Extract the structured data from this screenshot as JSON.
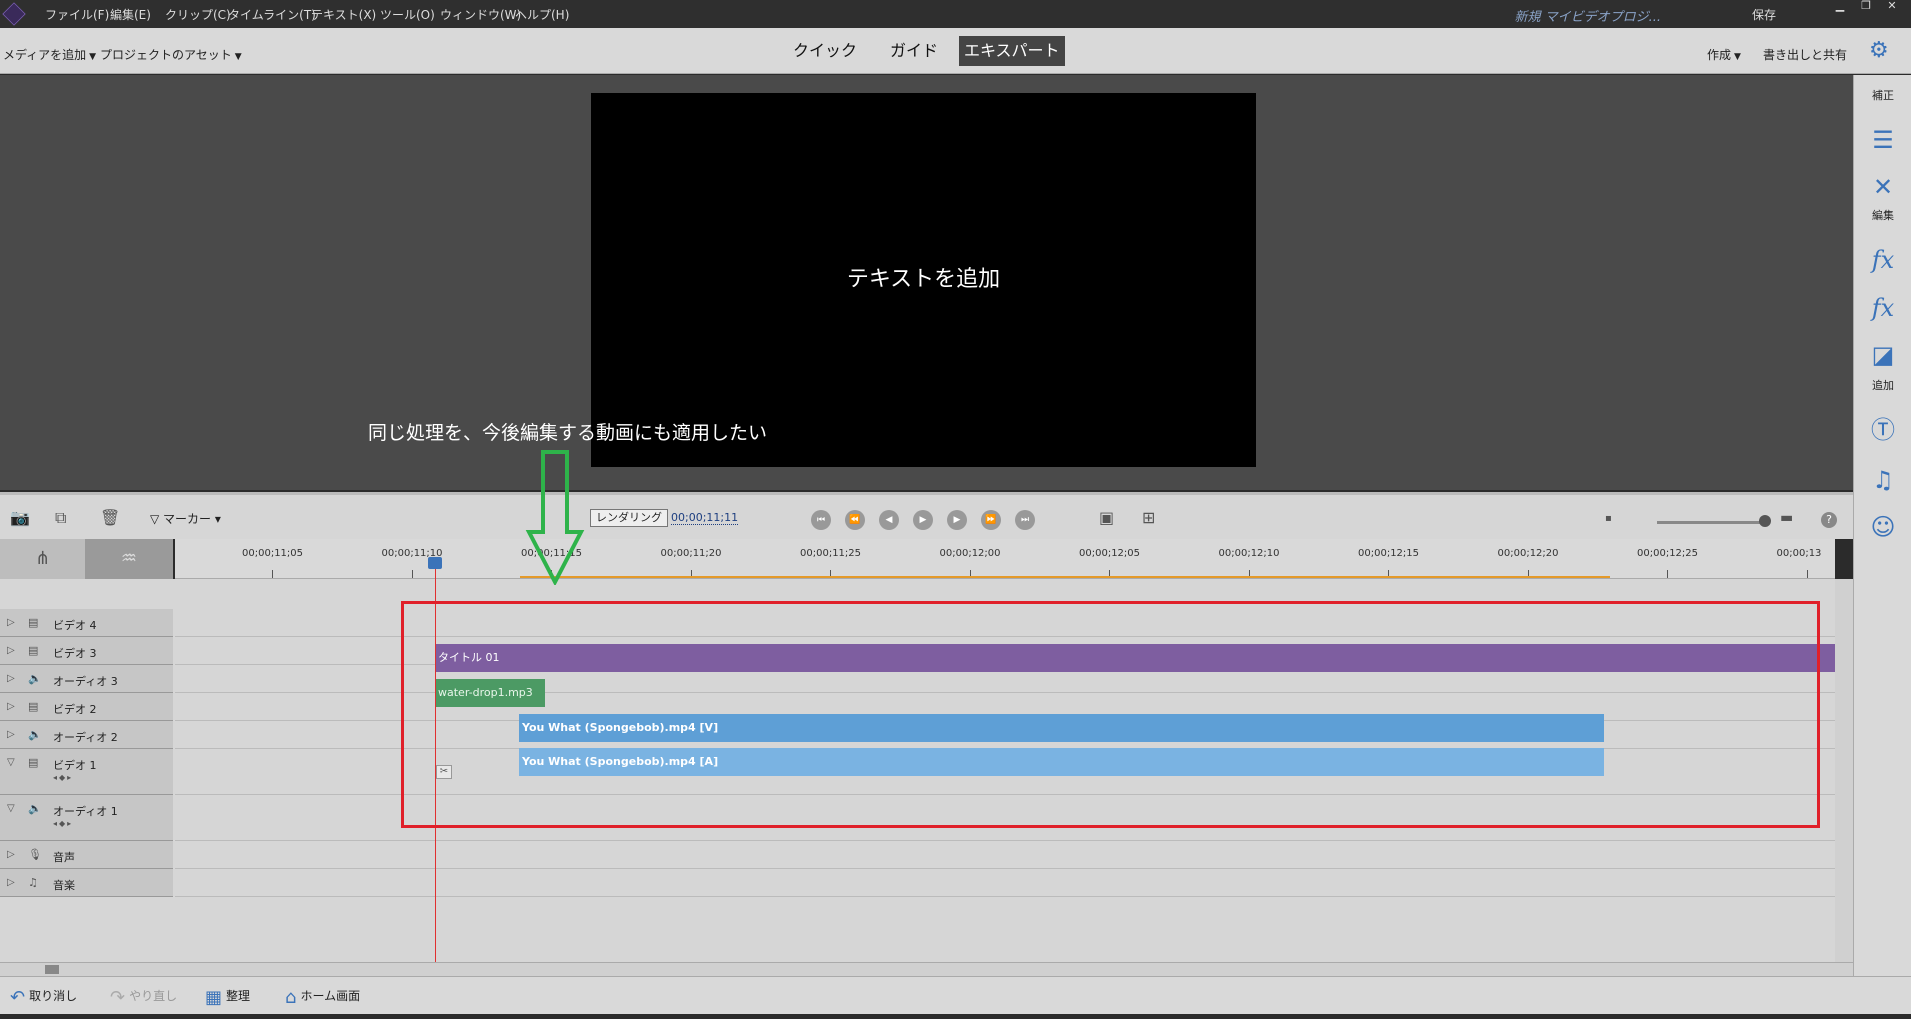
{
  "menu": {
    "items": [
      "ファイル(F)",
      "編集(E)",
      "クリップ(C)",
      "タイムライン(T)",
      "テキスト(X)",
      "ツール(O)",
      "ウィンドウ(W)",
      "ヘルプ(H)"
    ],
    "project_title": "新規 マイビデオプロジ...",
    "save_label": "保存"
  },
  "modebar": {
    "add_media": "メディアを追加",
    "project_assets": "プロジェクトのアセット",
    "tabs": [
      "クイック",
      "ガイド",
      "エキスパート"
    ],
    "active_tab": "エキスパート",
    "create": "作成",
    "export_share": "書き出しと共有"
  },
  "monitor": {
    "preview_text": "テキストを追加",
    "annotation": "同じ処理を、今後編集する動画にも適用したい"
  },
  "toolbar": {
    "marker_label": "マーカー",
    "render_label": "レンダリング",
    "timecode": "00;00;11;11"
  },
  "ruler": {
    "ticks": [
      "00;00;11;05",
      "00;00;11;10",
      "00;00;11;15",
      "00;00;11;20",
      "00;00;11;25",
      "00;00;12;00",
      "00;00;12;05",
      "00;00;12;10",
      "00;00;12;15",
      "00;00;12;20",
      "00;00;12;25",
      "00;00;13"
    ]
  },
  "tracks": [
    {
      "name": "ビデオ 4",
      "type": "video"
    },
    {
      "name": "ビデオ 3",
      "type": "video"
    },
    {
      "name": "オーディオ 3",
      "type": "audio"
    },
    {
      "name": "ビデオ 2",
      "type": "video"
    },
    {
      "name": "オーディオ 2",
      "type": "audio"
    },
    {
      "name": "ビデオ 1",
      "type": "video"
    },
    {
      "name": "オーディオ 1",
      "type": "audio"
    },
    {
      "name": "音声",
      "type": "voice"
    },
    {
      "name": "音楽",
      "type": "music"
    }
  ],
  "clips": {
    "title": "タイトル 01",
    "water": "water-drop1.mp3",
    "video": "You What (Spongebob).mp4 [V]",
    "audio": "You What (Spongebob).mp4 [A]"
  },
  "bottombar": {
    "undo": "取り消し",
    "redo": "やり直し",
    "organize": "整理",
    "home": "ホーム画面"
  },
  "right_panel": {
    "correct": "補正",
    "edit": "編集",
    "add": "追加"
  },
  "colors": {
    "accent": "#3b73b9",
    "title_clip": "#7e5ea0",
    "audio_clip": "#4c9a64",
    "video_clip": "#5e9fd6",
    "highlight_box": "#e0202a",
    "annotation_arrow": "#2eb34a"
  }
}
